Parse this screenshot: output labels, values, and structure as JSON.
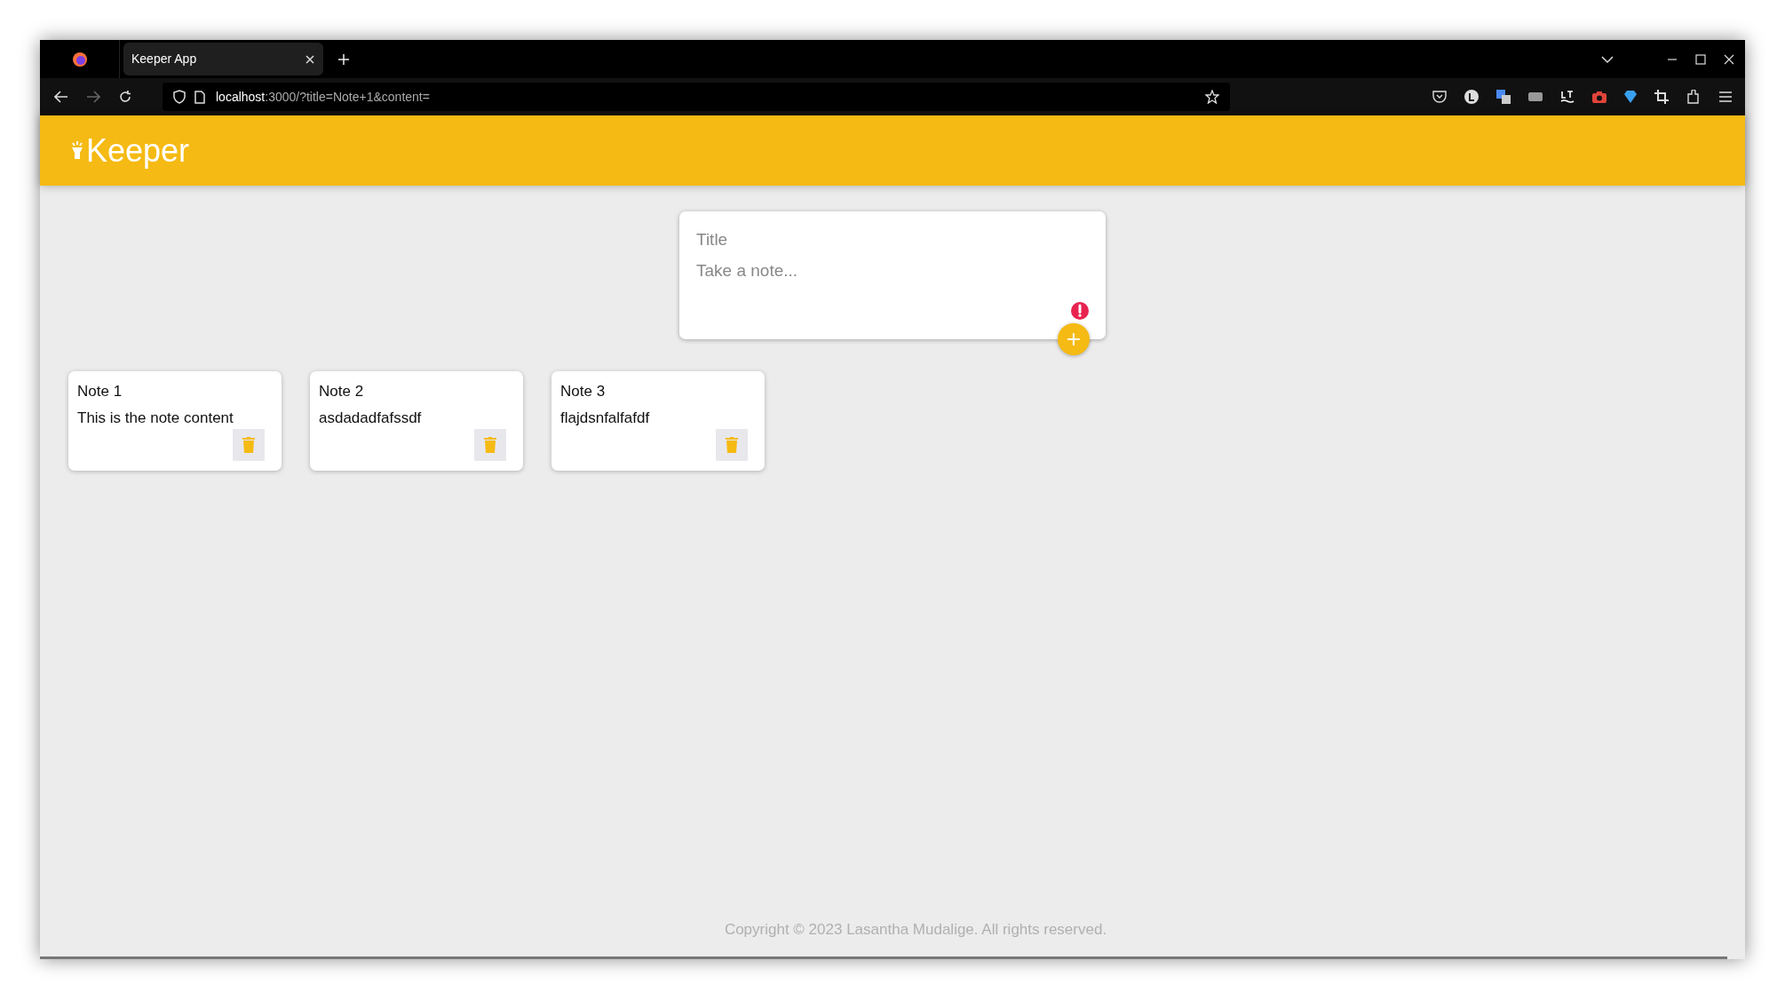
{
  "browser": {
    "tab": {
      "title": "Keeper App",
      "selected": true
    },
    "url_host": "localhost",
    "url_rest": ":3000/?title=Note+1&content="
  },
  "header": {
    "logo": "Keeper"
  },
  "form": {
    "title_placeholder": "Title",
    "content_placeholder": "Take a note...",
    "error": true,
    "add_button": "+"
  },
  "notes": [
    {
      "title": "Note 1",
      "content": "This is the note content"
    },
    {
      "title": "Note 2",
      "content": "asdadadfafssdf"
    },
    {
      "title": "Note 3",
      "content": "flajdsnfalfafdf"
    }
  ],
  "footer": "Copyright © 2023 Lasantha Mudalige. All rights reserved."
}
